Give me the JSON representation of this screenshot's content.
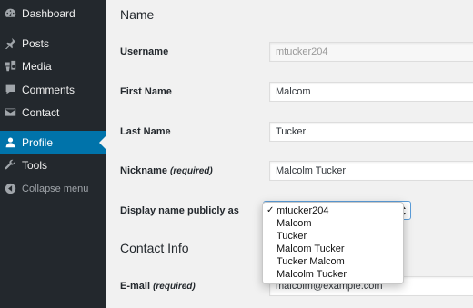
{
  "sidebar": {
    "items": [
      {
        "label": "Dashboard",
        "icon": "dashboard-icon"
      },
      {
        "label": "Posts",
        "icon": "pin-icon"
      },
      {
        "label": "Media",
        "icon": "media-icon"
      },
      {
        "label": "Comments",
        "icon": "comment-icon"
      },
      {
        "label": "Contact",
        "icon": "mail-icon"
      },
      {
        "label": "Profile",
        "icon": "user-icon",
        "active": true
      },
      {
        "label": "Tools",
        "icon": "wrench-icon"
      }
    ],
    "collapse_label": "Collapse menu"
  },
  "main": {
    "name_heading": "Name",
    "username": {
      "label": "Username",
      "value": "mtucker204"
    },
    "first_name": {
      "label": "First Name",
      "value": "Malcom"
    },
    "last_name": {
      "label": "Last Name",
      "value": "Tucker"
    },
    "nickname": {
      "label": "Nickname",
      "required": "(required)",
      "value": "Malcolm Tucker"
    },
    "display_name": {
      "label": "Display name publicly as",
      "options": [
        "mtucker204",
        "Malcom",
        "Tucker",
        "Malcom Tucker",
        "Tucker Malcom",
        "Malcolm Tucker"
      ],
      "selected_index": 0
    },
    "contact_heading": "Contact Info",
    "email": {
      "label": "E-mail",
      "required": "(required)",
      "value": "malcolm@example.com"
    }
  },
  "colors": {
    "sidebar_bg": "#23282d",
    "active_bg": "#0073aa",
    "page_bg": "#f1f1f1",
    "focus_border": "#5b9dd9"
  }
}
